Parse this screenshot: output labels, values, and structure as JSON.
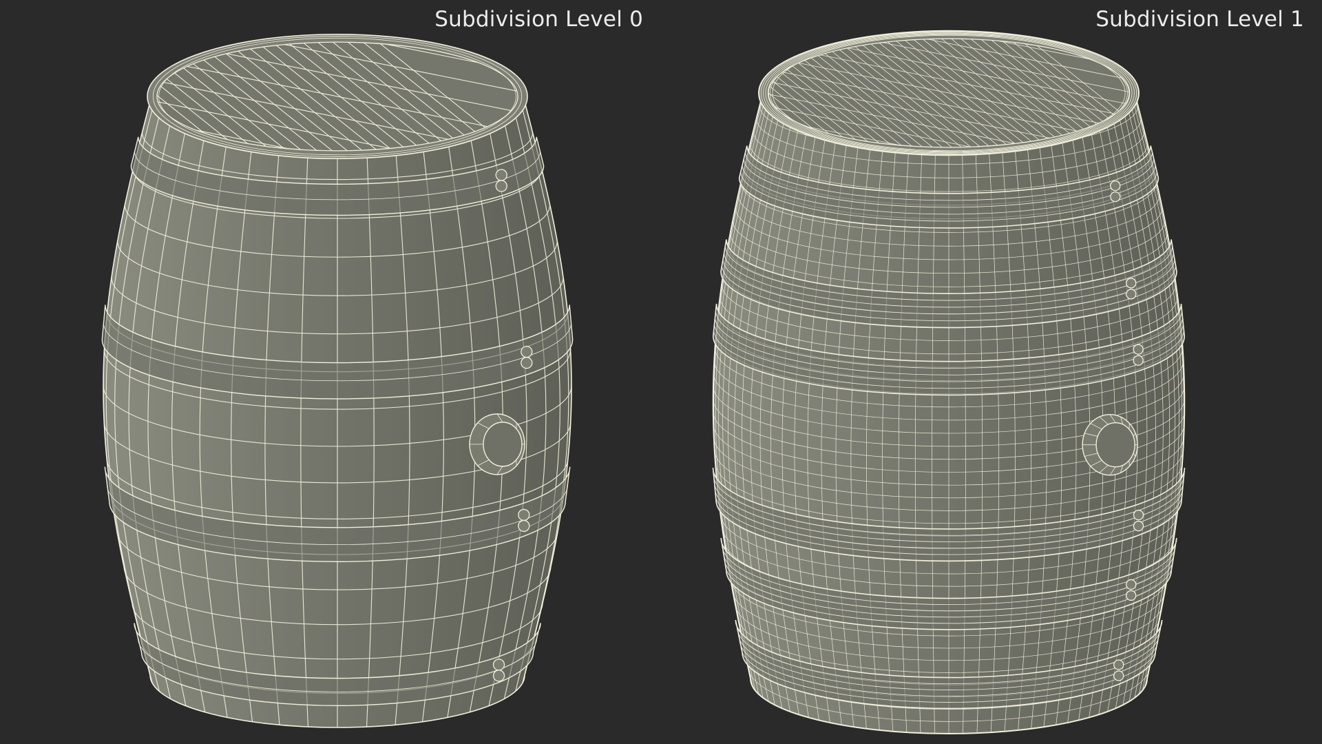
{
  "scene": {
    "background_color": "#2a2a2a",
    "mesh_fill_color": "#74766b",
    "wire_color": "#f2f0dc",
    "label_color": "#ececec"
  },
  "panels": [
    {
      "label": "Subdivision Level 0",
      "object": "barrel-wireframe",
      "subdivision_level": 0
    },
    {
      "label": "Subdivision Level 1",
      "object": "barrel-wireframe",
      "subdivision_level": 1
    }
  ]
}
